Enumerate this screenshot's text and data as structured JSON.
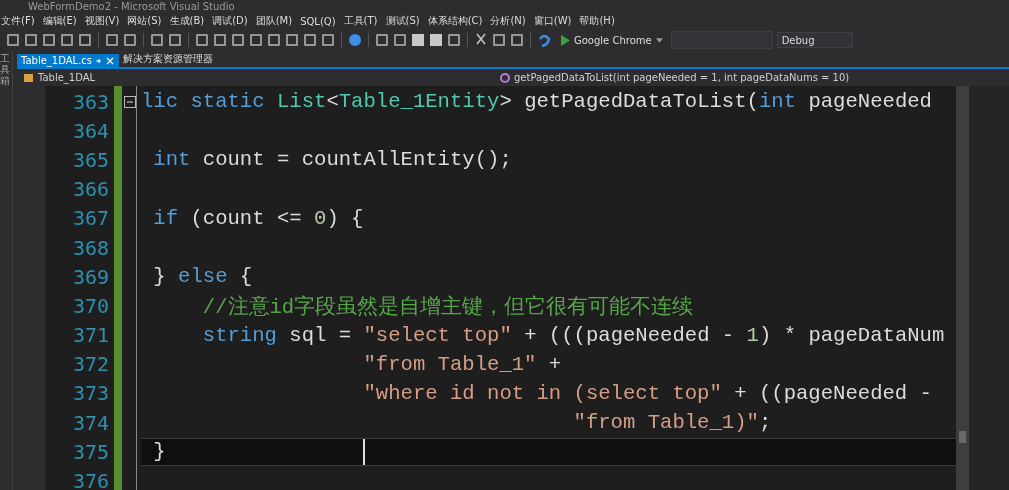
{
  "window": {
    "title": "WebFormDemo2 - Microsoft Visual Studio"
  },
  "menu": [
    "文件(F)",
    "编辑(E)",
    "视图(V)",
    "网站(S)",
    "生成(B)",
    "调试(D)",
    "团队(M)",
    "SQL(Q)",
    "工具(T)",
    "测试(S)",
    "体系结构(C)",
    "分析(N)",
    "窗口(W)",
    "帮助(H)"
  ],
  "toolbar": {
    "run_target": "Google Chrome",
    "configuration": "Debug"
  },
  "side_tab": "工具箱",
  "tabs": [
    {
      "label": "Table_1DAL.cs",
      "selected": true
    },
    {
      "label": "解决方案资源管理器",
      "selected": false
    }
  ],
  "nav": {
    "type": "Table_1DAL",
    "member": "getPagedDataToList(int pageNeeded = 1, int pageDataNums = 10)"
  },
  "lines": [
    {
      "number": "363",
      "fold": true,
      "current": false,
      "tokens": [
        {
          "kind": "kw",
          "text": "lic static "
        },
        {
          "kind": "type",
          "text": "List"
        },
        {
          "kind": "plain",
          "text": "<"
        },
        {
          "kind": "type",
          "text": "Table_1Entity"
        },
        {
          "kind": "plain",
          "text": "> getPagedDataToList("
        },
        {
          "kind": "kw",
          "text": "int"
        },
        {
          "kind": "plain",
          "text": " pageNeeded"
        }
      ]
    },
    {
      "number": "364",
      "fold": false,
      "current": false
    },
    {
      "number": "365",
      "fold": false,
      "current": false,
      "tokens": [
        {
          "kind": "kw",
          "text": " int"
        },
        {
          "kind": "plain",
          "text": " count = countAllEntity();"
        }
      ]
    },
    {
      "number": "366",
      "fold": false,
      "current": false
    },
    {
      "number": "367",
      "fold": false,
      "current": false,
      "tokens": [
        {
          "kind": "kw",
          "text": " if"
        },
        {
          "kind": "plain",
          "text": " (count <= "
        },
        {
          "kind": "num",
          "text": "0"
        },
        {
          "kind": "plain",
          "text": ") {"
        }
      ]
    },
    {
      "number": "368",
      "fold": false,
      "current": false
    },
    {
      "number": "369",
      "fold": false,
      "current": false,
      "tokens": [
        {
          "kind": "plain",
          "text": " } "
        },
        {
          "kind": "kw",
          "text": "else"
        },
        {
          "kind": "plain",
          "text": " {"
        }
      ]
    },
    {
      "number": "370",
      "fold": false,
      "current": false,
      "tokens": [
        {
          "kind": "cmt",
          "text": "     //注意id字段虽然是自增主键，但它很有可能不连续"
        }
      ]
    },
    {
      "number": "371",
      "fold": false,
      "current": false,
      "tokens": [
        {
          "kind": "kw",
          "text": "     string"
        },
        {
          "kind": "plain",
          "text": " sql = "
        },
        {
          "kind": "str",
          "text": "\"select top\""
        },
        {
          "kind": "plain",
          "text": " + (((pageNeeded - "
        },
        {
          "kind": "num",
          "text": "1"
        },
        {
          "kind": "plain",
          "text": ") * pageDataNum"
        }
      ]
    },
    {
      "number": "372",
      "fold": false,
      "current": false,
      "tokens": [
        {
          "kind": "str",
          "text": "                  \"from Table_1\""
        },
        {
          "kind": "plain",
          "text": " +"
        }
      ]
    },
    {
      "number": "373",
      "fold": false,
      "current": false,
      "tokens": [
        {
          "kind": "str",
          "text": "                  \"where id not in (select top\""
        },
        {
          "kind": "plain",
          "text": " + ((pageNeeded -"
        }
      ]
    },
    {
      "number": "374",
      "fold": false,
      "current": false,
      "tokens": [
        {
          "kind": "str",
          "text": "                                   \"from Table_1)\""
        },
        {
          "kind": "plain",
          "text": ";"
        }
      ]
    },
    {
      "number": "375",
      "fold": false,
      "current": true,
      "tokens": [
        {
          "kind": "plain",
          "text": " }"
        }
      ]
    },
    {
      "number": "376",
      "fold": false,
      "current": false
    }
  ]
}
